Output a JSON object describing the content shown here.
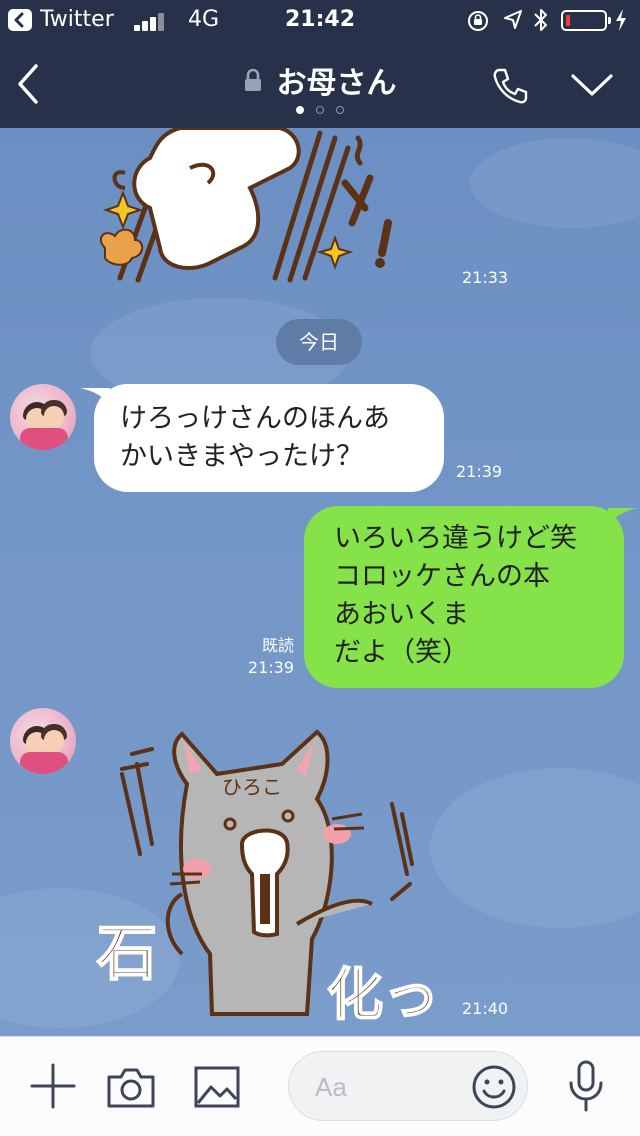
{
  "status_bar": {
    "back_app": "Twitter",
    "network": "4G",
    "time": "21:42"
  },
  "header": {
    "title": "お母さん",
    "page_dots": 3,
    "active_dot": 0,
    "icons": [
      "back-chevron-icon",
      "lock-icon",
      "phone-icon",
      "chevron-down-icon"
    ]
  },
  "chat": {
    "sticker_top": {
      "time": "21:33"
    },
    "day_separator": "今日",
    "messages": [
      {
        "from": "other",
        "text": "けろっけさんのほんあ\nかいきまやったけ？",
        "time": "21:39"
      },
      {
        "from": "me",
        "text": "いろいろ違うけど笑\nコロッケさんの本\nあおいくま\nだよ（笑）",
        "read": "既読",
        "time": "21:39"
      }
    ],
    "sticker_bottom": {
      "name_text": "ひろこ",
      "caption": "石化っ",
      "time": "21:40"
    }
  },
  "input_bar": {
    "placeholder": "Aa",
    "icons": [
      "plus-icon",
      "camera-icon",
      "image-icon",
      "emoji-icon",
      "microphone-icon"
    ]
  },
  "colors": {
    "header_bg": "#27324a",
    "chat_bg": "#7194c6",
    "outgoing_bubble": "#85e249",
    "incoming_bubble": "#ffffff"
  }
}
